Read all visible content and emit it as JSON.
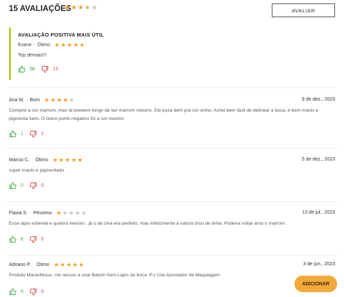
{
  "header": {
    "title": "15 AVALIAÇÕES",
    "rating": 3.5,
    "write_button": "AVALIAR"
  },
  "most_useful": {
    "title": "AVALIAÇÃO POSITIVA MAIS ÚTIL",
    "author": "Evane",
    "grade": "Ótimo",
    "rating": 5,
    "text": "Top demais!!!",
    "up": "58",
    "down": "13"
  },
  "reviews": [
    {
      "author": "Ana M.",
      "grade": "Bom",
      "rating": 4,
      "date": "9 de dez., 2023",
      "text": "Comprei a cor marrom, mas tá beeeem longe de ser marrom mesmo. Ele puxa bem pra cor vinho. Achei bem fácil de delinear a boca, é bem macio e pigmenta bem. O único ponto negativo foi a cor mesmo",
      "up": "1",
      "down": "1"
    },
    {
      "author": "Marcio C.",
      "grade": "Ótimo",
      "rating": 5,
      "date": "5 de dez., 2023",
      "text": "super macio e pigmentado",
      "up": "0",
      "down": "0"
    },
    {
      "author": "Flavia S.",
      "grade": "Péssimo",
      "rating": 1,
      "date": "13 de jul., 2023",
      "text": "Esse lápis esfarela e quebra mesmo , já o da Una era perfeito, mas infelizmente a natura tirou de linha. Poderia voltar amo o marrom.",
      "up": "6",
      "down": "0"
    },
    {
      "author": "Adriano P.",
      "grade": "Ótimo",
      "rating": 5,
      "date": "3 de jun., 2023",
      "text": "Produto Maravilhoso, me recuso a usar Batom Sem Lápis de boca. P.s Use Apontador de Maquiagem",
      "up": "5",
      "down": "0"
    }
  ],
  "add_button": "ADICIONAR",
  "colors": {
    "star": "#f0a030",
    "star_off": "#c8c8c8",
    "accent_bar": "#b9cc3b",
    "up": "#3aa63a",
    "down": "#d24848",
    "add_button": "#f2a93a"
  }
}
